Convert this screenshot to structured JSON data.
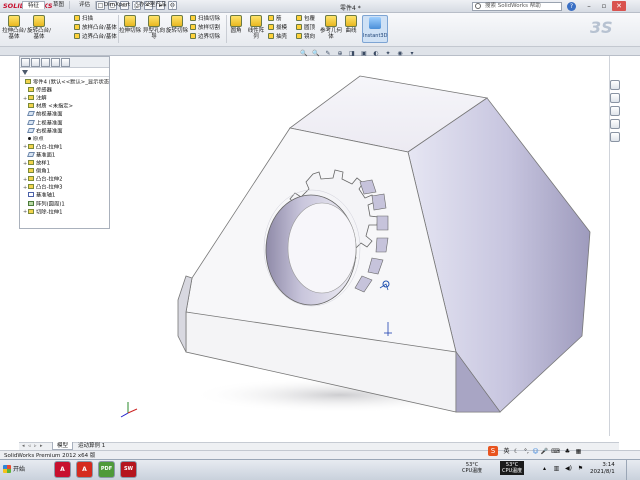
{
  "app": {
    "logo": "SOLIDWORKS",
    "document_title": "零件4 *",
    "search_placeholder": "搜索 SolidWorks 帮助",
    "quick_access": [
      "□",
      "▢",
      "▭",
      "⎙",
      "↶",
      "▸",
      "⚙"
    ],
    "window_controls": [
      "?",
      "–",
      "▫",
      "✕"
    ]
  },
  "ribbon": {
    "buttons": [
      {
        "label": "拉伸凸台/基体"
      },
      {
        "label": "旋转凸台/基体"
      },
      {
        "label": "拉伸切除"
      },
      {
        "label": "异型孔向导"
      },
      {
        "label": "旋转切除"
      },
      {
        "label": "圆角"
      },
      {
        "label": "线性阵列"
      },
      {
        "label": "参考几何体"
      },
      {
        "label": "曲线"
      }
    ],
    "small_items": [
      {
        "label": "扫描"
      },
      {
        "label": "放样凸台/基体"
      },
      {
        "label": "边界凸台/基体"
      },
      {
        "label": "扫描切除"
      },
      {
        "label": "放样切割"
      },
      {
        "label": "边界切除"
      },
      {
        "label": "筋"
      },
      {
        "label": "拔模"
      },
      {
        "label": "抽壳"
      },
      {
        "label": "包覆"
      },
      {
        "label": "圆顶"
      },
      {
        "label": "镜向"
      }
    ],
    "instant3d": "Instant3D"
  },
  "tabs": [
    "特征",
    "草图",
    "评估",
    "DimXpert",
    "办公室产品"
  ],
  "tree": {
    "items": [
      {
        "label": "零件4 (默认<<默认>_显示状态",
        "level": 0,
        "expand": "",
        "icon": "part"
      },
      {
        "label": "传感器",
        "level": 1,
        "expand": "",
        "icon": "sensor"
      },
      {
        "label": "注解",
        "level": 1,
        "expand": "+",
        "icon": "annot"
      },
      {
        "label": "材质 <未指定>",
        "level": 1,
        "expand": "",
        "icon": "material"
      },
      {
        "label": "前视基准面",
        "level": 1,
        "expand": "",
        "icon": "plane"
      },
      {
        "label": "上视基准面",
        "level": 1,
        "expand": "",
        "icon": "plane"
      },
      {
        "label": "右视基准面",
        "level": 1,
        "expand": "",
        "icon": "plane"
      },
      {
        "label": "原点",
        "level": 1,
        "expand": "",
        "icon": "pt"
      },
      {
        "label": "凸台-拉伸1",
        "level": 1,
        "expand": "+",
        "icon": "feat"
      },
      {
        "label": "基准面1",
        "level": 1,
        "expand": "",
        "icon": "plane"
      },
      {
        "label": "放样1",
        "level": 1,
        "expand": "+",
        "icon": "feat"
      },
      {
        "label": "倒角1",
        "level": 1,
        "expand": "",
        "icon": "feat"
      },
      {
        "label": "凸台-拉伸2",
        "level": 1,
        "expand": "+",
        "icon": "feat"
      },
      {
        "label": "凸台-拉伸3",
        "level": 1,
        "expand": "+",
        "icon": "feat"
      },
      {
        "label": "基准轴1",
        "level": 1,
        "expand": "",
        "icon": "sketch"
      },
      {
        "label": "阵列(圆周)1",
        "level": 1,
        "expand": "",
        "icon": "hole"
      },
      {
        "label": "切除-拉伸1",
        "level": 1,
        "expand": "+",
        "icon": "feat"
      }
    ]
  },
  "view_toolbar": [
    "🔍",
    "🔍",
    "✎",
    "⊕",
    "◨",
    "▣",
    "◐",
    "✦",
    "◉",
    "▾"
  ],
  "bottom_tabs": [
    "模型",
    "运动算例 1"
  ],
  "status_text": "SolidWorks Premium 2012 x64 版",
  "taskbar": {
    "start": "开始",
    "apps": [
      {
        "label": "A",
        "color": "#c8102e"
      },
      {
        "label": "A",
        "color": "#d52b1e"
      },
      {
        "label": "PDF",
        "color": "#4f9a3a"
      },
      {
        "label": "SW",
        "color": "#b5161e"
      }
    ],
    "cpu_temp1": "53°C",
    "cpu_label1": "CPU温度",
    "cpu_temp2": "53°C",
    "cpu_label2": "CPU温度",
    "ime": "英",
    "time": "3:14",
    "date": "2021/8/1"
  }
}
